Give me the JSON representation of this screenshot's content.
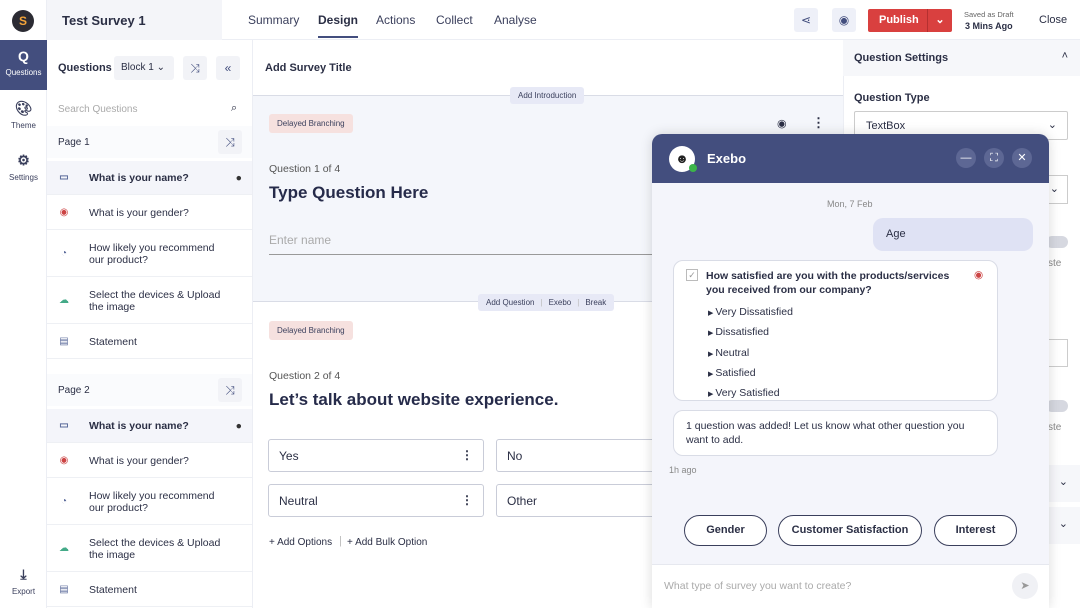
{
  "app": {
    "title": "Test Survey 1"
  },
  "rail": {
    "items": [
      {
        "label": "Questions",
        "icon": "Q"
      },
      {
        "label": "Theme"
      },
      {
        "label": "Settings"
      },
      {
        "label": "Export"
      }
    ]
  },
  "tabs": [
    "Summary",
    "Design",
    "Actions",
    "Collect",
    "Analyse"
  ],
  "header": {
    "publish": "Publish",
    "saved_label": "Saved as Draft",
    "saved_time": "3 Mins Ago",
    "close": "Close"
  },
  "questions_panel": {
    "title": "Questions",
    "block": "Block 1",
    "search_placeholder": "Search Questions",
    "pages": [
      {
        "label": "Page 1",
        "items": [
          "What is your name?",
          "What is your gender?",
          "How likely you recommend our product?",
          "Select the devices & Upload the image",
          "Statement"
        ]
      },
      {
        "label": "Page 2",
        "items": [
          "What is your name?",
          "What is your gender?",
          "How likely you recommend our product?",
          "Select the devices & Upload the image",
          "Statement"
        ]
      }
    ]
  },
  "canvas": {
    "add_title": "Add Survey Title",
    "add_intro": "Add Introduction",
    "branching": "Delayed Branching",
    "q1": {
      "counter": "Question 1 of 4",
      "title": "Type Question Here",
      "placeholder": "Enter name"
    },
    "inserts": [
      "Add Question",
      "Exebo",
      "Break"
    ],
    "q2": {
      "counter": "Question 2 of 4",
      "title": "Let’s talk about website experience.",
      "options": [
        "Yes",
        "No",
        "Neutral",
        "Other"
      ],
      "add_options": "+ Add Options",
      "add_bulk": "+ Add Bulk Option"
    }
  },
  "settings": {
    "title": "Question Settings",
    "type_label": "Question Type",
    "type_value": "TextBox",
    "partial1": "ste",
    "partial2": "ste"
  },
  "chat": {
    "name": "Exebo",
    "date": "Mon, 7 Feb",
    "user_msg": "Age",
    "question": "How satisfied are you with the products/services you received from our company?",
    "choices": [
      "Very Dissatisfied",
      "Dissatisfied",
      "Neutral",
      "Satisfied",
      "Very Satisfied"
    ],
    "bot_msg": "1 question was added! Let us know what other question you want to add.",
    "time": "1h ago",
    "suggestions": [
      "Gender",
      "Customer Satisfaction",
      "Interest"
    ],
    "input_placeholder": "What type of survey you want to create?"
  },
  "colors": {
    "primary": "#434e7e",
    "publish": "#d9403f",
    "branch_badge": "#f6e1df"
  }
}
